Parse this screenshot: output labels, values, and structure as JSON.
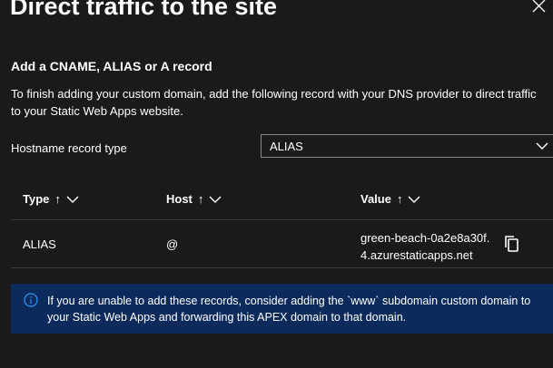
{
  "panel": {
    "title": "Direct traffic to the site",
    "close_icon": "close-icon"
  },
  "section": {
    "title": "Add a CNAME, ALIAS or A record",
    "description": "To finish adding your custom domain, add the following record with your DNS provider to direct traffic to your Static Web Apps website."
  },
  "hostname_field": {
    "label": "Hostname record type",
    "selected": "ALIAS",
    "icon": "chevron-down-icon"
  },
  "table": {
    "columns": [
      {
        "label": "Type",
        "sort_arrow": "↑"
      },
      {
        "label": "Host",
        "sort_arrow": "↑"
      },
      {
        "label": "Value",
        "sort_arrow": "↑"
      }
    ],
    "rows": [
      {
        "type": "ALIAS",
        "host": "@",
        "value": "green-beach-0a2e8a30f.4.azurestaticapps.net",
        "copy_icon": "copy-icon"
      }
    ]
  },
  "info_bar": {
    "icon": "info-icon",
    "text": "If you are unable to add these records, consider adding the `www` subdomain custom domain to your Static Web Apps and forwarding this APEX domain to that domain."
  },
  "colors": {
    "background": "#1b1a19",
    "info_background": "#0c2a5c",
    "info_icon": "#2899f5",
    "divider": "#3b3a39"
  }
}
